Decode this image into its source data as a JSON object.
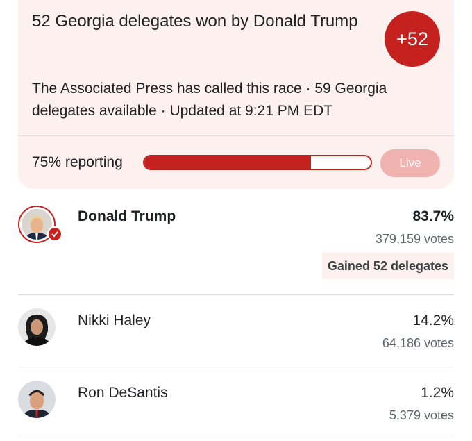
{
  "summary": {
    "headline": "52 Georgia delegates won by Donald Trump",
    "badge": "+52",
    "description": "The Associated Press has called this race · 59 Georgia delegates available · Updated at 9:21 PM EDT",
    "reporting_label": "75% reporting",
    "reporting_fraction": 0.75,
    "live_label": "Live"
  },
  "colors": {
    "accent": "#c5221f",
    "card_bg": "#fdf1f0",
    "live_bg": "#f1b3b0"
  },
  "candidates": [
    {
      "name": "Donald Trump",
      "percent": "83.7%",
      "votes": "379,159 votes",
      "delegates_note": "Gained 52 delegates",
      "winner": true,
      "icon": "checkmark-icon"
    },
    {
      "name": "Nikki Haley",
      "percent": "14.2%",
      "votes": "64,186 votes",
      "winner": false
    },
    {
      "name": "Ron DeSantis",
      "percent": "1.2%",
      "votes": "5,379 votes",
      "winner": false
    }
  ]
}
